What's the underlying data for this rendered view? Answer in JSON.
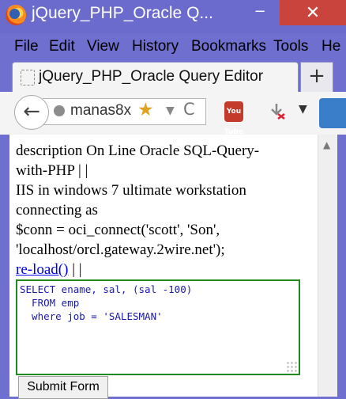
{
  "window": {
    "title": "jQuery_PHP_Oracle Q...",
    "minimize": "−",
    "maximize": "",
    "close": "✕"
  },
  "menu": [
    "File",
    "Edit",
    "View",
    "History",
    "Bookmarks",
    "Tools",
    "He"
  ],
  "tab": {
    "title": "jQuery_PHP_Oracle Query Editor",
    "new_tab": "+"
  },
  "nav": {
    "back": "←",
    "url": "manas8x",
    "star": "★",
    "dropdown": "▼",
    "reload": "C",
    "youtube_label": "You Tube",
    "menu_dropdown": "▼"
  },
  "page": {
    "description_line1": "description On Line Oracle SQL-Query-",
    "description_line2": "with-PHP | |",
    "description_line3": "IIS in windows 7 ultimate workstation",
    "description_line4": "connecting as",
    "description_line5": "$conn = oci_connect('scott', 'Son',",
    "description_line6": "'localhost/orcl.gateway.2wire.net');",
    "reload_link": "re-load()",
    "after_link": "| |",
    "query": "SELECT ename, sal, (sal -100)\n  FROM emp\n  where job = 'SALESMAN'",
    "submit": "Submit Form"
  },
  "colors": {
    "chrome": "#6f6fd0",
    "close_button": "#c9443d",
    "editor_border": "#1f8a1f",
    "query_text": "#1a1aa8"
  }
}
